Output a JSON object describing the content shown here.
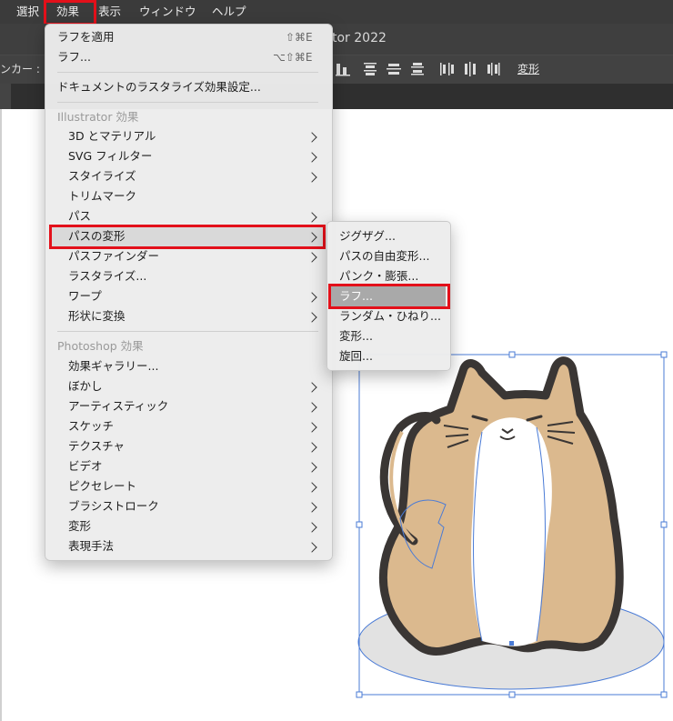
{
  "menubar": {
    "items": [
      "選択",
      "効果",
      "表示",
      "ウィンドウ",
      "ヘルプ"
    ],
    "highlight_color": "#e3101a"
  },
  "window": {
    "title": "tor 2022"
  },
  "control_bar": {
    "label": "ンカー :",
    "transform_label": "変形"
  },
  "effect_menu": {
    "apply_rough": {
      "label": "ラフを適用",
      "shortcut": "⇧⌘E"
    },
    "rough": {
      "label": "ラフ...",
      "shortcut": "⌥⇧⌘E"
    },
    "doc_raster": {
      "label": "ドキュメントのラスタライズ効果設定..."
    },
    "illustrator_section": "Illustrator 効果",
    "illustrator_items": [
      {
        "label": "3D とマテリアル"
      },
      {
        "label": "SVG フィルター"
      },
      {
        "label": "スタイライズ"
      },
      {
        "label": "トリムマーク"
      },
      {
        "label": "パス"
      },
      {
        "label": "パスの変形"
      },
      {
        "label": "パスファインダー"
      },
      {
        "label": "ラスタライズ..."
      },
      {
        "label": "ワープ"
      },
      {
        "label": "形状に変換"
      }
    ],
    "photoshop_section": "Photoshop 効果",
    "photoshop_items": [
      {
        "label": "効果ギャラリー..."
      },
      {
        "label": "ぼかし"
      },
      {
        "label": "アーティスティック"
      },
      {
        "label": "スケッチ"
      },
      {
        "label": "テクスチャ"
      },
      {
        "label": "ビデオ"
      },
      {
        "label": "ピクセレート"
      },
      {
        "label": "ブラシストローク"
      },
      {
        "label": "変形"
      },
      {
        "label": "表現手法"
      }
    ]
  },
  "submenu": {
    "items": [
      {
        "label": "ジグザグ..."
      },
      {
        "label": "パスの自由変形..."
      },
      {
        "label": "パンク・膨張..."
      },
      {
        "label": "ラフ..."
      },
      {
        "label": "ランダム・ひねり..."
      },
      {
        "label": "変形..."
      },
      {
        "label": "旋回..."
      }
    ]
  },
  "colors": {
    "cat_fill": "#dbb98e",
    "cat_outline": "#3a3634",
    "selection": "#4a7bd6",
    "shadow": "#e2e2e2"
  }
}
